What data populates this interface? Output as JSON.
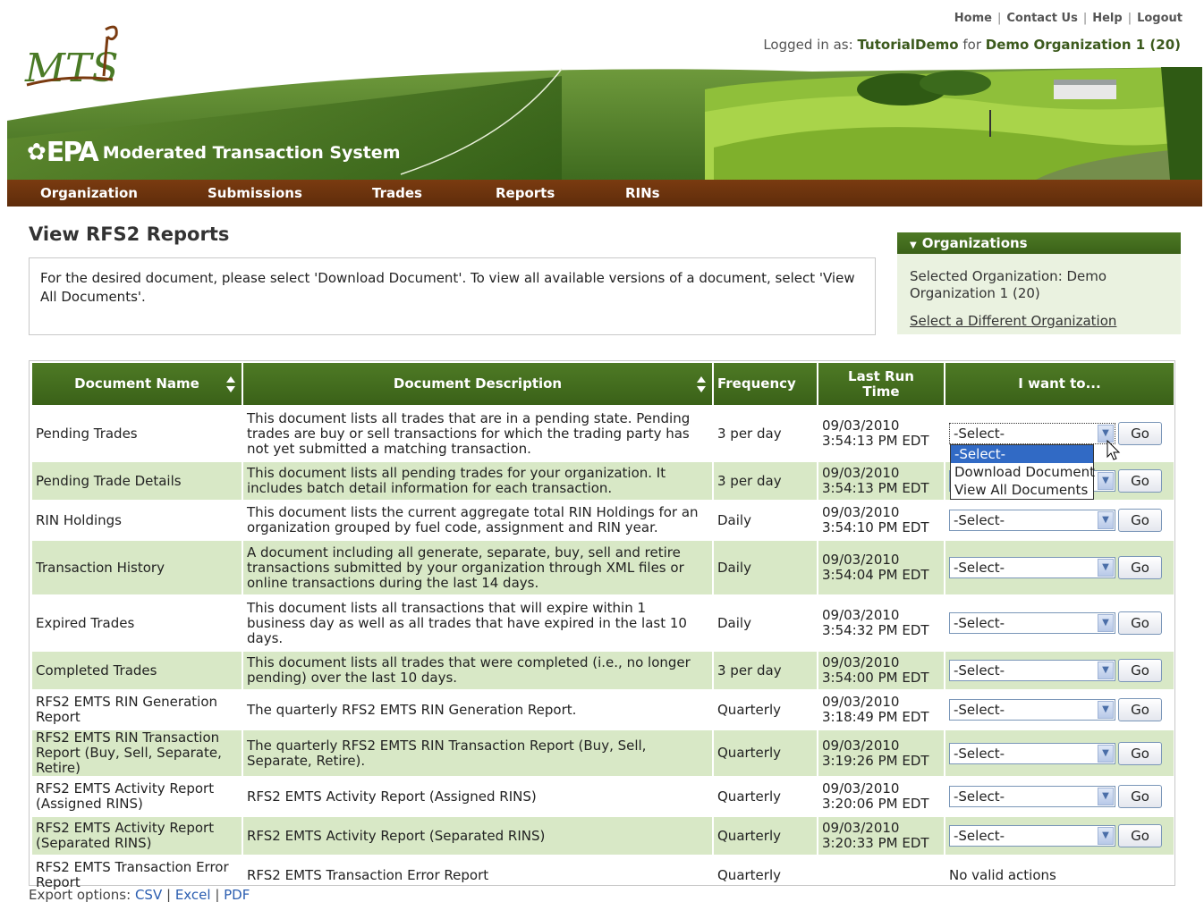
{
  "header": {
    "top_links": [
      "Home",
      "Contact Us",
      "Help",
      "Logout"
    ],
    "logged_in_prefix": "Logged in as:",
    "user": "TutorialDemo",
    "for_text": "for",
    "org": "Demo Organization 1 (20)",
    "logo_text": "MTS",
    "epa_text": "EPA",
    "system_title": "Moderated Transaction System"
  },
  "nav": [
    "Organization",
    "Submissions",
    "Trades",
    "Reports",
    "RINs"
  ],
  "page": {
    "title": "View RFS2 Reports",
    "info": "For the desired document, please select 'Download Document'. To view all available versions of a document, select 'View All Documents'."
  },
  "org_panel": {
    "title": "Organizations",
    "selected": "Selected Organization: Demo Organization 1 (20)",
    "change_link": "Select a Different Organization"
  },
  "table": {
    "headers": [
      "Document Name",
      "Document Description",
      "Frequency",
      "Last Run Time",
      "I want to..."
    ],
    "go_label": "Go",
    "select_default": "-Select-",
    "no_actions": "No valid actions",
    "rows": [
      {
        "name": "Pending Trades",
        "desc": "This document lists all trades that are in a pending state. Pending trades are buy or sell transactions for which the trading party has not yet submitted a matching transaction.",
        "freq": "3 per day",
        "date": "09/03/2010",
        "time": "3:54:13 PM EDT",
        "action": "select"
      },
      {
        "name": "Pending Trade Details",
        "desc": "This document lists all pending trades for your organization. It includes batch detail information for each transaction.",
        "freq": "3 per day",
        "date": "09/03/2010",
        "time": "3:54:13 PM EDT",
        "action": "select"
      },
      {
        "name": "RIN Holdings",
        "desc": "This document lists the current aggregate total RIN Holdings for an organization grouped by fuel code, assignment and RIN year.",
        "freq": "Daily",
        "date": "09/03/2010",
        "time": "3:54:10 PM EDT",
        "action": "select"
      },
      {
        "name": "Transaction History",
        "desc": "A document including all generate, separate, buy, sell and retire transactions submitted by your organization through XML files or online transactions during the last 14 days.",
        "freq": "Daily",
        "date": "09/03/2010",
        "time": "3:54:04 PM EDT",
        "action": "select"
      },
      {
        "name": "Expired Trades",
        "desc": "This document lists all transactions that will expire within 1 business day as well as all trades that have expired in the last 10 days.",
        "freq": "Daily",
        "date": "09/03/2010",
        "time": "3:54:32 PM EDT",
        "action": "select"
      },
      {
        "name": "Completed Trades",
        "desc": "This document lists all trades that were completed (i.e., no longer pending) over the last 10 days.",
        "freq": "3 per day",
        "date": "09/03/2010",
        "time": "3:54:00 PM EDT",
        "action": "select"
      },
      {
        "name": "RFS2 EMTS RIN Generation Report",
        "desc": "The quarterly RFS2 EMTS RIN Generation Report.",
        "freq": "Quarterly",
        "date": "09/03/2010",
        "time": "3:18:49 PM EDT",
        "action": "select"
      },
      {
        "name": "RFS2 EMTS RIN Transaction Report (Buy, Sell, Separate, Retire)",
        "desc": "The quarterly RFS2 EMTS RIN Transaction Report (Buy, Sell, Separate, Retire).",
        "freq": "Quarterly",
        "date": "09/03/2010",
        "time": "3:19:26 PM EDT",
        "action": "select"
      },
      {
        "name": "RFS2 EMTS Activity Report (Assigned RINS)",
        "desc": "RFS2 EMTS Activity Report (Assigned RINS)",
        "freq": "Quarterly",
        "date": "09/03/2010",
        "time": "3:20:06 PM EDT",
        "action": "select"
      },
      {
        "name": "RFS2 EMTS Activity Report (Separated RINS)",
        "desc": "RFS2 EMTS Activity Report (Separated RINS)",
        "freq": "Quarterly",
        "date": "09/03/2010",
        "time": "3:20:33 PM EDT",
        "action": "select"
      },
      {
        "name": "RFS2 EMTS Transaction Error Report",
        "desc": "RFS2 EMTS Transaction Error Report",
        "freq": "Quarterly",
        "date": "",
        "time": "",
        "action": "none"
      }
    ]
  },
  "dropdown": {
    "options": [
      "-Select-",
      "Download Document",
      "View All Documents"
    ],
    "highlighted": 0
  },
  "footer": {
    "export_label": "Export options:",
    "links": [
      "CSV",
      "Excel",
      "PDF"
    ]
  }
}
